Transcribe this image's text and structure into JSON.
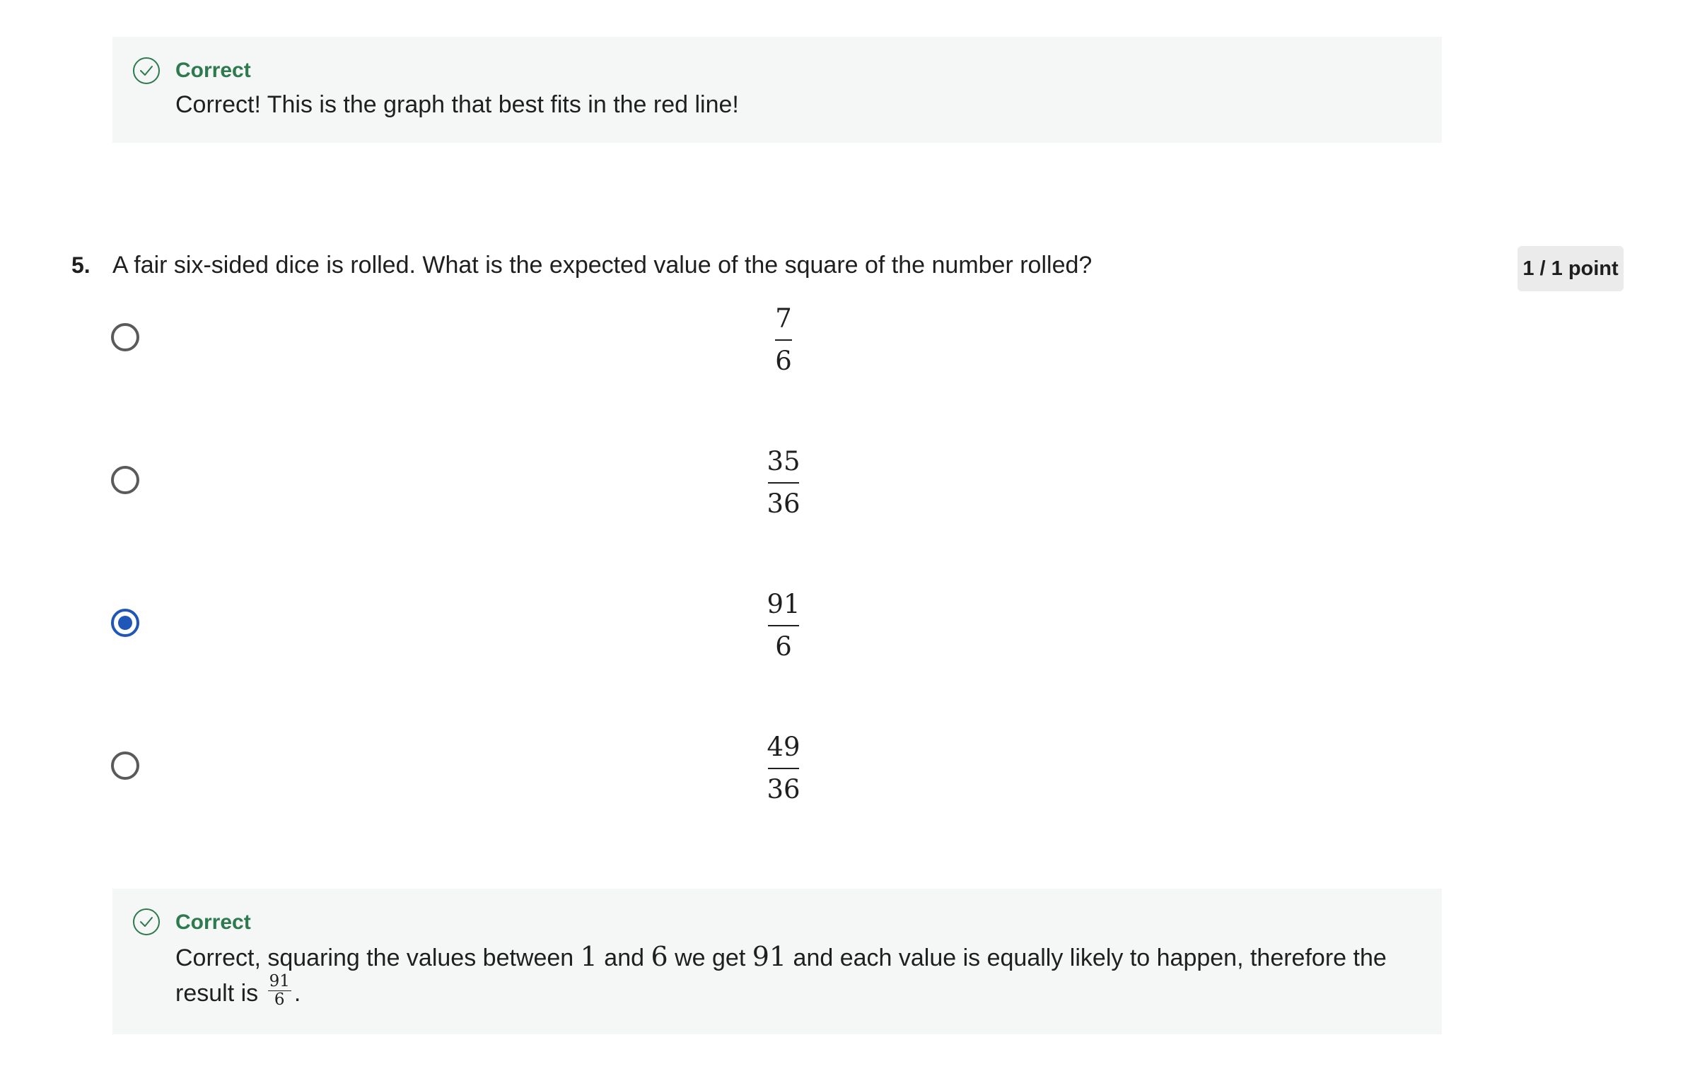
{
  "feedback_top": {
    "status": "Correct",
    "message": "Correct! This is the graph that best fits in the red line!",
    "icon": "check-circle-icon"
  },
  "question": {
    "number": "5.",
    "text": "A fair six-sided dice is rolled. What is the expected value of the square of the number rolled?",
    "points": "1 / 1 point",
    "options": [
      {
        "numerator": "7",
        "denominator": "6",
        "selected": false
      },
      {
        "numerator": "35",
        "denominator": "36",
        "selected": false
      },
      {
        "numerator": "91",
        "denominator": "6",
        "selected": true
      },
      {
        "numerator": "49",
        "denominator": "36",
        "selected": false
      }
    ]
  },
  "feedback_bottom": {
    "status": "Correct",
    "icon": "check-circle-icon",
    "part1": "Correct, squaring the values between ",
    "val1": "1",
    "part2": " and ",
    "val2": "6",
    "part3": " we get ",
    "val3": "91",
    "part4": " and each value is equally likely to happen, therefore the result is ",
    "frac_num": "91",
    "frac_den": "6",
    "end": "."
  },
  "colors": {
    "correct_green": "#2d7a4e",
    "selected_blue": "#1f57b8",
    "feedback_bg": "#f5f7f6",
    "badge_bg": "#ebebeb"
  }
}
